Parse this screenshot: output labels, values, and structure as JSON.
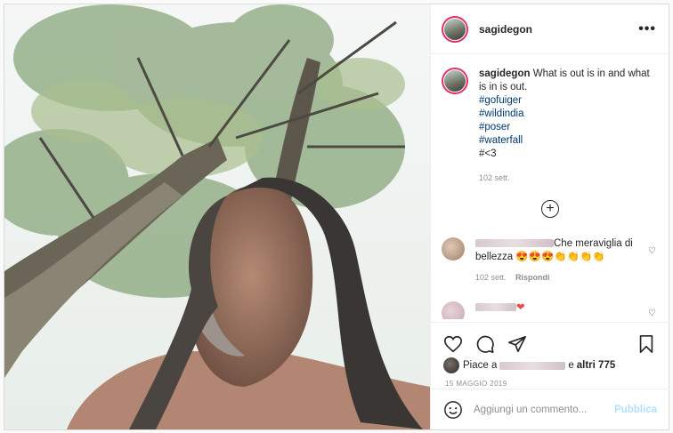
{
  "post": {
    "username": "sagidegon",
    "more_label": "•••",
    "caption": {
      "username": "sagidegon",
      "text": "What is out is in and what is in is out.",
      "hashtags": [
        "#gofuiger",
        "#wildindia",
        "#poser",
        "#waterfall"
      ],
      "extra": "#<3",
      "age": "102 sett."
    },
    "load_more_label": "+",
    "comments": [
      {
        "text_suffix": "Che meraviglia di bellezza 😍😍😍👏👏👏👏",
        "age": "102 sett.",
        "reply_label": "Rispondi"
      },
      {
        "text_suffix": "❤"
      }
    ],
    "likes": {
      "prefix": "Piace a",
      "connector": "e",
      "others": "altri 775"
    },
    "date": "15 MAGGIO 2019",
    "add_comment": {
      "placeholder": "Aggiungi un commento...",
      "publish_label": "Pubblica"
    }
  },
  "colors": {
    "link": "#00376b",
    "muted": "#8e8e8e",
    "publish_disabled": "#b2dffc",
    "story_ring": "#e1306c"
  }
}
